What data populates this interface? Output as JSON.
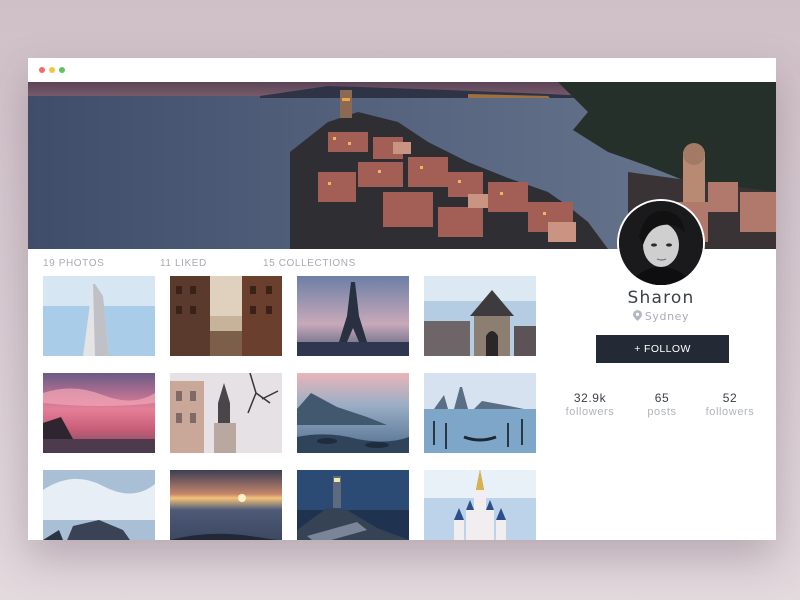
{
  "window": {
    "controls": [
      "close",
      "minimize",
      "maximize"
    ]
  },
  "cover": {
    "description_icon": "coastal-village-cover-photo"
  },
  "tabs": {
    "photos": "19 PHOTOS",
    "liked": "11 LIKED",
    "collections": "15 COLLECTIONS"
  },
  "profile": {
    "name": "Sharon",
    "location": "Sydney",
    "follow_label": "+ FOLLOW"
  },
  "stats": [
    {
      "value": "32.9k",
      "label": "followers"
    },
    {
      "value": "65",
      "label": "posts"
    },
    {
      "value": "52",
      "label": "followers"
    }
  ],
  "colors": {
    "button": "#232a35",
    "muted_text": "#a7abb3",
    "name_text": "#3c3f46",
    "dot_red": "#f46b6b",
    "dot_yellow": "#f6c444",
    "dot_green": "#5dc559"
  },
  "photos": [
    "flatiron-building-photo",
    "street-buildings-photo",
    "eiffel-tower-photo",
    "castle-gate-photo",
    "pink-sunset-sea-photo",
    "church-spire-photo",
    "misty-coast-photo",
    "venice-gondolas-photo",
    "wave-rocks-photo",
    "sunset-horizon-photo",
    "lighthouse-photo",
    "disney-castle-photo"
  ]
}
